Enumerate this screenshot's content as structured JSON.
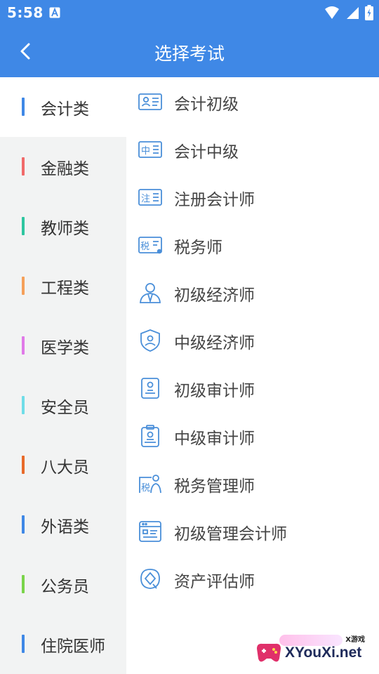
{
  "status_bar": {
    "time": "5:58"
  },
  "header": {
    "title": "选择考试"
  },
  "categories": [
    {
      "label": "会计类",
      "color": "#3f88e6",
      "active": true
    },
    {
      "label": "金融类",
      "color": "#f06a6a"
    },
    {
      "label": "教师类",
      "color": "#2ec6a0"
    },
    {
      "label": "工程类",
      "color": "#f5a05a"
    },
    {
      "label": "医学类",
      "color": "#e07ae8"
    },
    {
      "label": "安全员",
      "color": "#6fdde8"
    },
    {
      "label": "八大员",
      "color": "#e86a2a"
    },
    {
      "label": "外语类",
      "color": "#3f88e6"
    },
    {
      "label": "公务员",
      "color": "#7ad44a"
    },
    {
      "label": "住院医师",
      "color": "#3f88e6"
    }
  ],
  "exams": [
    {
      "label": "会计初级",
      "icon": "id-card-icon"
    },
    {
      "label": "会计中级",
      "icon": "zhong-badge-icon",
      "icon_text": "中"
    },
    {
      "label": "注册会计师",
      "icon": "zhu-badge-icon",
      "icon_text": "注"
    },
    {
      "label": "税务师",
      "icon": "shui-badge-icon",
      "icon_text": "税"
    },
    {
      "label": "初级经济师",
      "icon": "person-icon"
    },
    {
      "label": "中级经济师",
      "icon": "shield-icon"
    },
    {
      "label": "初级审计师",
      "icon": "stamp-doc-icon"
    },
    {
      "label": "中级审计师",
      "icon": "clipboard-stamp-icon"
    },
    {
      "label": "税务管理师",
      "icon": "tax-person-icon",
      "icon_text": "税"
    },
    {
      "label": "初级管理会计师",
      "icon": "form-window-icon"
    },
    {
      "label": "资产评估师",
      "icon": "diamond-search-icon"
    }
  ],
  "watermark": {
    "small": "X游戏",
    "text": "XYouXi.net"
  },
  "colors": {
    "primary": "#3f88e6",
    "icon": "#4a8fd9",
    "sidebar_bg": "#f2f3f3"
  }
}
